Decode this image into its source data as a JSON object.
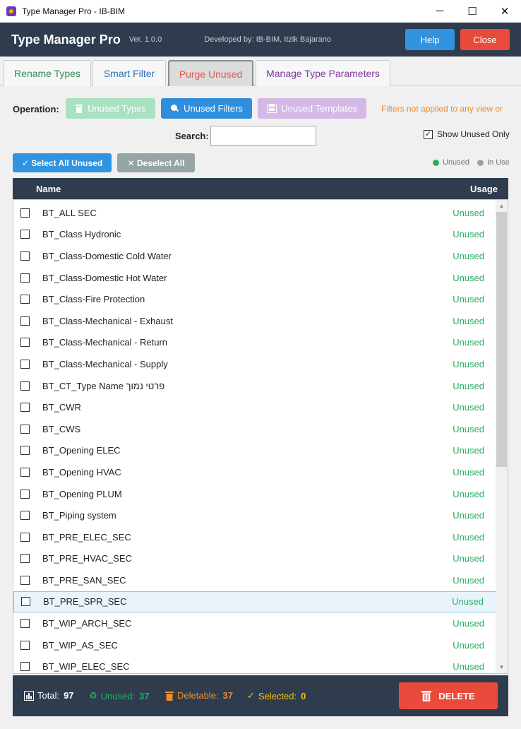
{
  "window": {
    "title": "Type Manager Pro - IB-BIM",
    "minimize": "─",
    "maximize": "☐",
    "close": "✕"
  },
  "header": {
    "app_name": "Type Manager Pro",
    "version": "Ver. 1.0.0",
    "developer": "Developed by: IB-BIM, Itzik Bajarano",
    "help_label": "Help",
    "close_label": "Close"
  },
  "tabs": [
    "Rename Types",
    "Smart Filter",
    "Purge Unused",
    "Manage Type Parameters"
  ],
  "active_tab": "Purge Unused",
  "operation": {
    "label": "Operation:",
    "unused_types": "Unused Types",
    "unused_filters": "Unused Filters",
    "unused_templates": "Unused Templates",
    "selected": "Unused Filters",
    "note": "Filters not applied to any view or"
  },
  "search": {
    "label": "Search:",
    "value": ""
  },
  "show_unused": {
    "label": "Show Unused Only",
    "checked": true
  },
  "select_all_label": "✓ Select All Unused",
  "deselect_all_label": "✕ Deselect All",
  "legend": {
    "unused": "Unused",
    "in_use": "In Use"
  },
  "colors": {
    "unused": "#27ae60",
    "in_use": "#95a5a6",
    "header_bg": "#2e3c4e",
    "accent": "#3193e0",
    "danger": "#e84b3c"
  },
  "list": {
    "columns": {
      "name": "Name",
      "usage": "Usage"
    },
    "rows": [
      {
        "name": "BT_ALL SEC",
        "usage": "Unused"
      },
      {
        "name": "BT_Class Hydronic",
        "usage": "Unused"
      },
      {
        "name": "BT_Class-Domestic Cold Water",
        "usage": "Unused"
      },
      {
        "name": "BT_Class-Domestic Hot Water",
        "usage": "Unused"
      },
      {
        "name": "BT_Class-Fire Protection",
        "usage": "Unused"
      },
      {
        "name": "BT_Class-Mechanical - Exhaust",
        "usage": "Unused"
      },
      {
        "name": "BT_Class-Mechanical - Return",
        "usage": "Unused"
      },
      {
        "name": "BT_Class-Mechanical - Supply",
        "usage": "Unused"
      },
      {
        "name": "BT_CT_Type Name פרטי נמוך",
        "usage": "Unused"
      },
      {
        "name": "BT_CWR",
        "usage": "Unused"
      },
      {
        "name": "BT_CWS",
        "usage": "Unused"
      },
      {
        "name": "BT_Opening ELEC",
        "usage": "Unused"
      },
      {
        "name": "BT_Opening HVAC",
        "usage": "Unused"
      },
      {
        "name": "BT_Opening PLUM",
        "usage": "Unused"
      },
      {
        "name": "BT_Piping system",
        "usage": "Unused"
      },
      {
        "name": "BT_PRE_ELEC_SEC",
        "usage": "Unused"
      },
      {
        "name": "BT_PRE_HVAC_SEC",
        "usage": "Unused"
      },
      {
        "name": "BT_PRE_SAN_SEC",
        "usage": "Unused"
      },
      {
        "name": "BT_PRE_SPR_SEC",
        "usage": "Unused",
        "highlighted": true
      },
      {
        "name": "BT_WIP_ARCH_SEC",
        "usage": "Unused"
      },
      {
        "name": "BT_WIP_AS_SEC",
        "usage": "Unused"
      },
      {
        "name": "BT_WIP_ELEC_SEC",
        "usage": "Unused"
      }
    ]
  },
  "footer": {
    "total_label": "Total:",
    "total": "97",
    "unused_label": "Unused:",
    "unused": "37",
    "deletable_label": "Deletable:",
    "deletable": "37",
    "selected_label": "Selected:",
    "selected": "0",
    "delete_label": "DELETE"
  }
}
